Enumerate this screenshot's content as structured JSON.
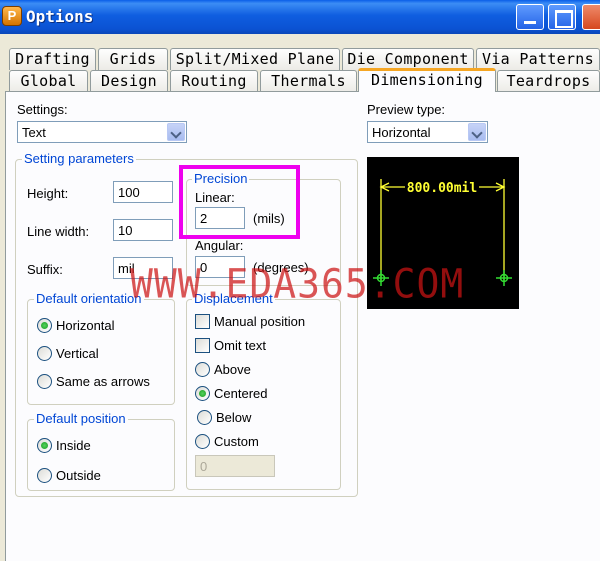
{
  "window": {
    "title": "Options"
  },
  "tabs_back": [
    "Drafting",
    "Grids",
    "Split/Mixed Plane",
    "Die Component",
    "Via Patterns"
  ],
  "tabs_front": [
    "Global",
    "Design",
    "Routing",
    "Thermals",
    "Dimensioning",
    "Teardrops"
  ],
  "active_tab": "Dimensioning",
  "settings": {
    "label": "Settings:",
    "value": "Text"
  },
  "preview_type": {
    "label": "Preview type:",
    "value": "Horizontal"
  },
  "setting_parameters": {
    "label": "Setting parameters",
    "height_label": "Height:",
    "height_value": "100",
    "line_width_label": "Line width:",
    "line_width_value": "10",
    "suffix_label": "Suffix:",
    "suffix_value": "mil"
  },
  "precision": {
    "label": "Precision",
    "linear_label": "Linear:",
    "linear_value": "2",
    "linear_unit": "(mils)",
    "angular_label": "Angular:",
    "angular_value": "0",
    "angular_unit": "(degrees)"
  },
  "default_orientation": {
    "label": "Default orientation",
    "options": [
      "Horizontal",
      "Vertical",
      "Same as arrows"
    ],
    "selected": "Horizontal"
  },
  "default_position": {
    "label": "Default position",
    "options": [
      "Inside",
      "Outside"
    ],
    "selected": "Inside"
  },
  "displacement": {
    "label": "Displacement",
    "checkboxes": [
      "Manual position",
      "Omit text"
    ],
    "options": [
      "Above",
      "Centered",
      "Below",
      "Custom"
    ],
    "selected": "Centered",
    "custom_value": "0"
  },
  "preview": {
    "dimension_text": "800.00mil"
  },
  "watermark": "WWW.EDA365.COM",
  "colors": {
    "highlight": "#ee00ee",
    "preview_lines": "#ffff33",
    "preview_markers": "#33dd33",
    "group_label": "#0046d5"
  }
}
